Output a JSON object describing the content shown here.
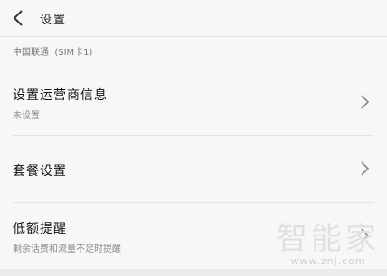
{
  "header": {
    "title": "设置",
    "back_icon": "chevron-left-icon"
  },
  "sim": {
    "label": "中国联通  (SIM卡1)"
  },
  "rows": [
    {
      "title": "设置运营商信息",
      "subtitle": "未设置",
      "icon": "chevron-right-icon"
    },
    {
      "title": "套餐设置",
      "subtitle": "",
      "icon": "chevron-right-icon"
    },
    {
      "title": "低额提醒",
      "subtitle": "剩余话费和流量不足时提醒",
      "icon": "chevron-right-icon"
    }
  ],
  "watermark": {
    "logo": "智能家",
    "url": "www.znj.com"
  }
}
